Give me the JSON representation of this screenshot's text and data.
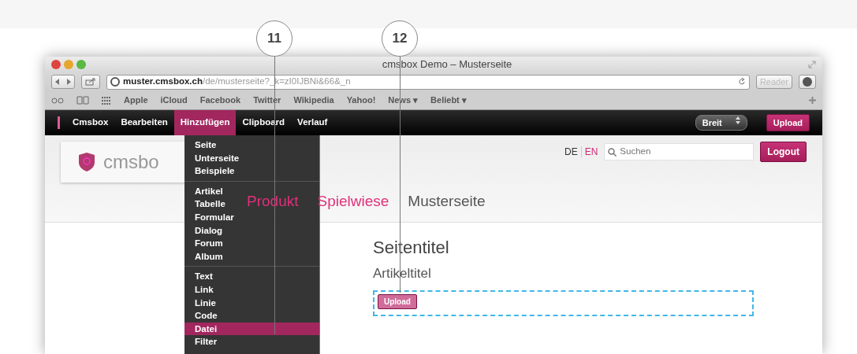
{
  "window": {
    "title": "cmsbox Demo – Musterseite"
  },
  "toolbar": {
    "url_host": "muster.cmsbox.ch",
    "url_path": "/de/musterseite?_k=zI0IJBNi&66&_n",
    "reader": "Reader"
  },
  "bookmarks": [
    {
      "label": "Apple"
    },
    {
      "label": "iCloud"
    },
    {
      "label": "Facebook"
    },
    {
      "label": "Twitter"
    },
    {
      "label": "Wikipedia"
    },
    {
      "label": "Yahoo!"
    },
    {
      "label": "News ▾"
    },
    {
      "label": "Beliebt ▾"
    }
  ],
  "cms_bar": {
    "items": [
      {
        "label": "Cmsbox",
        "selected": false
      },
      {
        "label": "Bearbeiten",
        "selected": false
      },
      {
        "label": "Hinzufügen",
        "selected": true
      },
      {
        "label": "Clipboard",
        "selected": false
      },
      {
        "label": "Verlauf",
        "selected": false
      }
    ],
    "width_select": "Breit",
    "upload": "Upload"
  },
  "menu": {
    "groups": [
      {
        "items": [
          {
            "label": "Seite",
            "selected": false
          },
          {
            "label": "Unterseite",
            "selected": false
          },
          {
            "label": "Beispiele",
            "selected": false
          }
        ]
      },
      {
        "items": [
          {
            "label": "Artikel",
            "selected": false
          },
          {
            "label": "Tabelle",
            "selected": false
          },
          {
            "label": "Formular",
            "selected": false
          },
          {
            "label": "Dialog",
            "selected": false
          },
          {
            "label": "Forum",
            "selected": false
          },
          {
            "label": "Album",
            "selected": false
          }
        ]
      },
      {
        "items": [
          {
            "label": "Text",
            "selected": false
          },
          {
            "label": "Link",
            "selected": false
          },
          {
            "label": "Linie",
            "selected": false
          },
          {
            "label": "Code",
            "selected": false
          },
          {
            "label": "Datei",
            "selected": true
          },
          {
            "label": "Filter",
            "selected": false
          }
        ]
      }
    ]
  },
  "header": {
    "logo": "cmsbo",
    "languages": [
      {
        "label": "DE",
        "selected": true
      },
      {
        "label": "EN",
        "selected": false
      }
    ],
    "search": {
      "placeholder": "Suchen"
    },
    "logout": "Logout"
  },
  "nav": [
    {
      "label": "Produkt",
      "selected": false
    },
    {
      "label": "Spielwiese",
      "selected": false
    },
    {
      "label": "Musterseite",
      "selected": true
    }
  ],
  "content": {
    "page_title": "Seitentitel",
    "article_title": "Artikeltitel",
    "upload": "Upload"
  },
  "callouts": [
    {
      "label": "11"
    },
    {
      "label": "12"
    }
  ]
}
